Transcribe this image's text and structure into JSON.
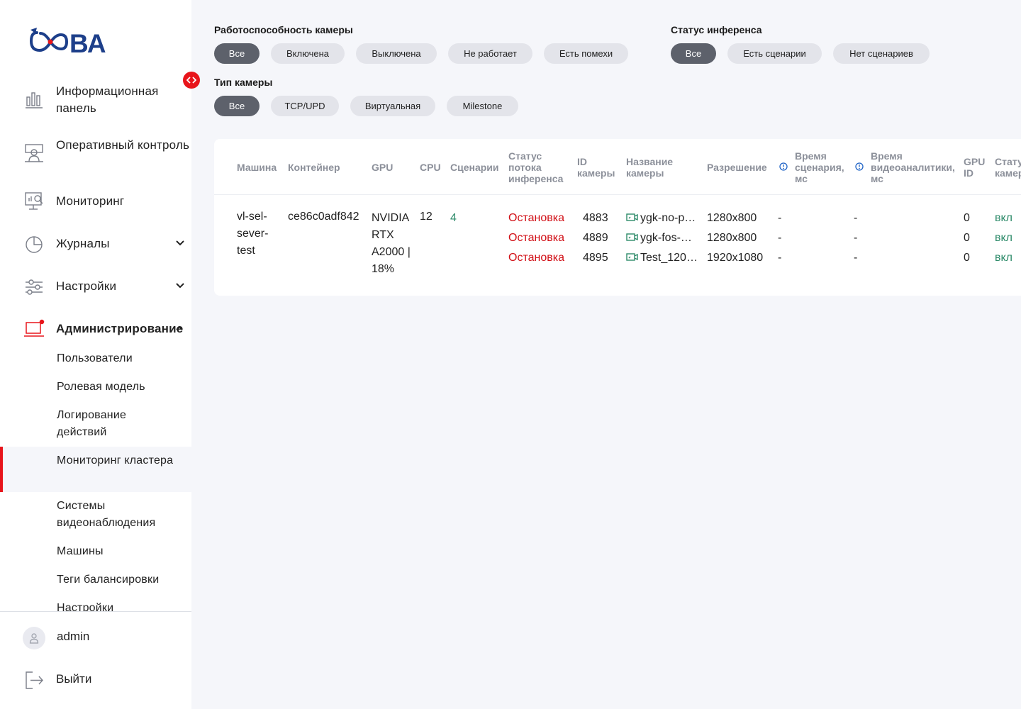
{
  "brand": {
    "logo_text": "ᏣᏫВА",
    "accent_color": "#e8151b",
    "logo_color": "#1d3f8a"
  },
  "sidebar": {
    "collapse_icon": "code-brackets-icon",
    "items": [
      {
        "label": "Информационная панель",
        "icon": "bar-chart-icon"
      },
      {
        "label": "Оперативный контроль",
        "icon": "operator-desk-icon"
      },
      {
        "label": "Мониторинг",
        "icon": "monitor-analytics-icon"
      },
      {
        "label": "Журналы",
        "icon": "pie-chart-icon",
        "expandable": true
      },
      {
        "label": "Настройки",
        "icon": "sliders-icon",
        "expandable": true
      },
      {
        "label": "Администрирование",
        "icon": "admin-laptop-icon",
        "expanded": true
      }
    ],
    "admin_subitems": [
      {
        "label": "Пользователи"
      },
      {
        "label": "Ролевая модель"
      },
      {
        "label": "Логирование действий"
      },
      {
        "label": "Мониторинг кластера",
        "active": true
      },
      {
        "label": "Системы видеонаблюдения"
      },
      {
        "label": "Машины"
      },
      {
        "label": "Теги балансировки"
      },
      {
        "label": "Настройки"
      }
    ],
    "user": {
      "name": "admin"
    },
    "logout_label": "Выйти"
  },
  "filters": {
    "health": {
      "title": "Работоспособность камеры",
      "options": [
        "Все",
        "Включена",
        "Выключена",
        "Не работает",
        "Есть помехи"
      ],
      "selected": "Все"
    },
    "inference": {
      "title": "Статус инференса",
      "options": [
        "Все",
        "Есть сценарии",
        "Нет сценариев"
      ],
      "selected": "Все"
    },
    "camera_type": {
      "title": "Тип камеры",
      "options": [
        "Все",
        "TCP/UPD",
        "Виртуальная",
        "Milestone"
      ],
      "selected": "Все"
    }
  },
  "table": {
    "headers": {
      "machine": "Машина",
      "container": "Контейнер",
      "gpu": "GPU",
      "cpu": "CPU",
      "scenarios": "Сценарии",
      "stream_status": "Статус потока инференса",
      "camera_id": "ID камеры",
      "camera_name": "Название камеры",
      "resolution": "Разрешение",
      "scenario_time": "Время сценария, мс",
      "analytics_time": "Время видеоаналитики, мс",
      "gpu_id": "GPU ID",
      "camera_status": "Статус камеры"
    },
    "row": {
      "machine": "vl-sel-sever-test",
      "container": "ce86c0adf842",
      "gpu": "NVIDIA RTX A2000 | 18%",
      "cpu": "12",
      "scenarios": "4",
      "streams": [
        {
          "status": "Остановка",
          "camera_id": "4883",
          "camera_name": "ygk-no-p…",
          "resolution": "1280x800",
          "scenario_time": "-",
          "analytics_time": "-",
          "gpu_id": "0",
          "camera_status": "вкл"
        },
        {
          "status": "Остановка",
          "camera_id": "4889",
          "camera_name": "ygk-fos-…",
          "resolution": "1280x800",
          "scenario_time": "-",
          "analytics_time": "-",
          "gpu_id": "0",
          "camera_status": "вкл"
        },
        {
          "status": "Остановка",
          "camera_id": "4895",
          "camera_name": "Test_120…",
          "resolution": "1920x1080",
          "scenario_time": "-",
          "analytics_time": "-",
          "gpu_id": "0",
          "camera_status": "вкл"
        }
      ]
    }
  }
}
